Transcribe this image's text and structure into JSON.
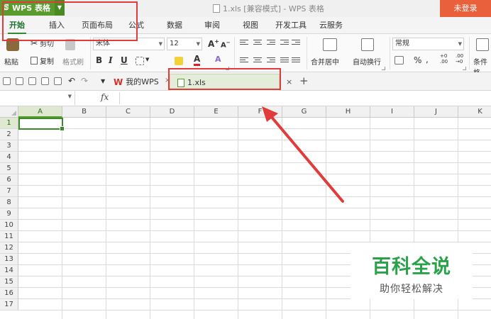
{
  "titlebar": {
    "app_label": "WPS 表格",
    "doc_title": "1.xls [兼容模式] - WPS 表格",
    "login_label": "未登录"
  },
  "menu": {
    "tabs": [
      "开始",
      "插入",
      "页面布局",
      "公式",
      "数据",
      "审阅",
      "视图",
      "开发工具",
      "云服务"
    ],
    "active": "开始"
  },
  "ribbon": {
    "paste": "粘贴",
    "cut": "剪切",
    "copy": "复制",
    "format_painter": "格式刷",
    "font_name": "宋体",
    "font_size": "12",
    "bold": "B",
    "italic": "I",
    "underline": "U",
    "merge_center": "合并居中",
    "wrap_text": "自动换行",
    "number_format": "常规",
    "percent": "%",
    "conditional_format": "条件格"
  },
  "tabs_row": {
    "my_wps": "我的WPS",
    "file_tab": "1.xls",
    "close": "×",
    "add": "+"
  },
  "formula_bar": {
    "fx": "fx",
    "value": ""
  },
  "sheet": {
    "columns": [
      "A",
      "B",
      "C",
      "D",
      "E",
      "F",
      "G",
      "H",
      "I",
      "J",
      "K"
    ],
    "rows": [
      "1",
      "2",
      "3",
      "4",
      "5",
      "6",
      "7",
      "8",
      "9",
      "10",
      "11",
      "12",
      "13",
      "14",
      "15",
      "16",
      "17"
    ],
    "active_cell": "A1"
  },
  "watermark": {
    "title": "百科全说",
    "subtitle": "助你轻松解决"
  },
  "colors": {
    "accent_green": "#5a9b2e",
    "login_orange": "#e8603c",
    "annotation_red": "#e23b3b",
    "watermark_green": "#2aa24a"
  }
}
